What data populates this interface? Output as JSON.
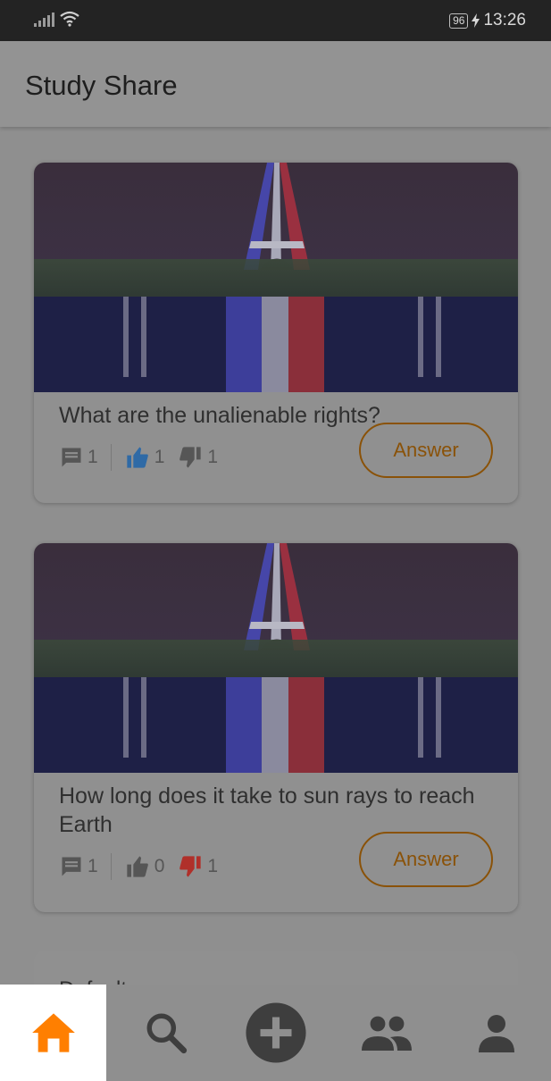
{
  "status_bar": {
    "battery": "96",
    "time": "13:26"
  },
  "app": {
    "title": "Study Share"
  },
  "colors": {
    "accent": "#ff7f00",
    "like": "#2f6aa6",
    "dislike": "#b0302a",
    "answer": "#8a5208"
  },
  "questions": [
    {
      "text": "What are the unalienable rights?",
      "comments": "1",
      "likes": "1",
      "dislikes": "1",
      "answer_label": "Answer",
      "liked": true,
      "disliked": false
    },
    {
      "text": "How long does it take to sun rays to reach Earth",
      "comments": "1",
      "likes": "0",
      "dislikes": "1",
      "answer_label": "Answer",
      "liked": false,
      "disliked": true
    }
  ],
  "peek_card": {
    "text": "Default"
  },
  "bottom_nav": [
    {
      "icon": "home-icon",
      "active": true
    },
    {
      "icon": "search-icon",
      "active": false
    },
    {
      "icon": "add-icon",
      "active": false
    },
    {
      "icon": "groups-icon",
      "active": false
    },
    {
      "icon": "profile-icon",
      "active": false
    }
  ]
}
